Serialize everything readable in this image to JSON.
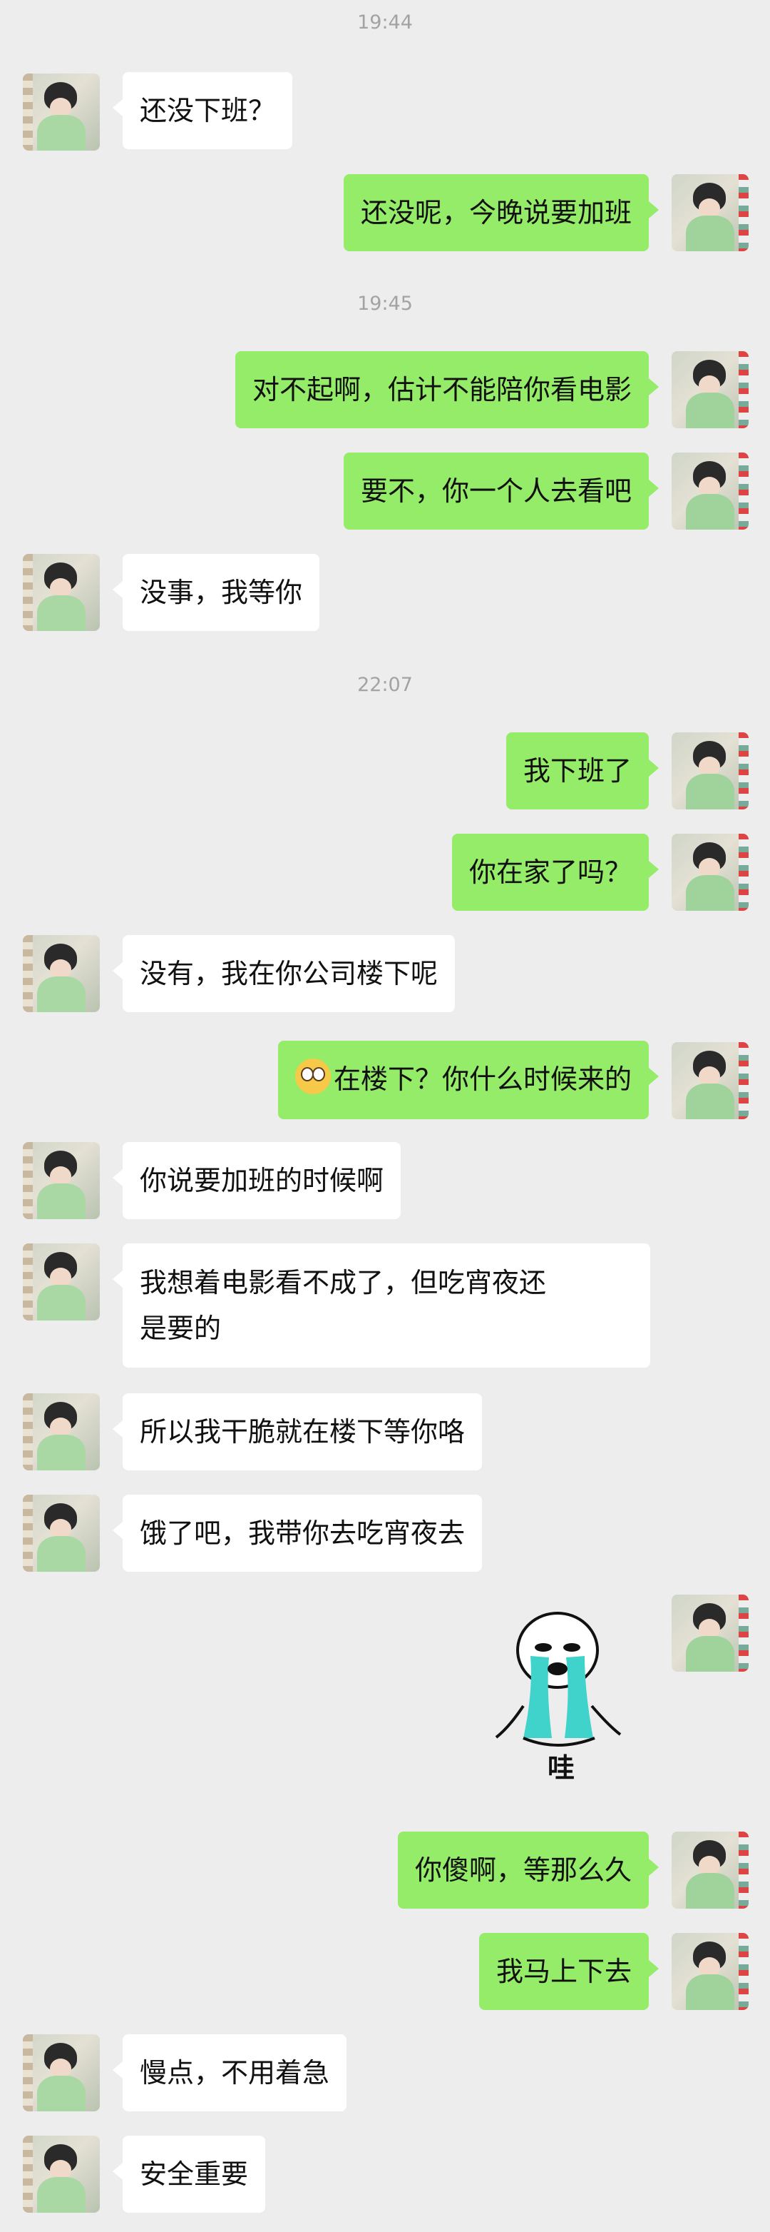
{
  "times": [
    "19:44",
    "19:45",
    "22:07"
  ],
  "messages": [
    {
      "side": "in",
      "text": "还没下班？"
    },
    {
      "side": "out",
      "text": "还没呢，今晚说要加班"
    },
    {
      "side": "out",
      "text": "对不起啊，估计不能陪你看电影"
    },
    {
      "side": "out",
      "text": "要不，你一个人去看吧"
    },
    {
      "side": "in",
      "text": "没事，我等你"
    },
    {
      "side": "out",
      "text": "我下班了"
    },
    {
      "side": "out",
      "text": "你在家了吗？"
    },
    {
      "side": "in",
      "text": "没有，我在你公司楼下呢"
    },
    {
      "side": "out",
      "text": "在楼下？你什么时候来的",
      "emoji": "flushed-face-icon"
    },
    {
      "side": "in",
      "text": "你说要加班的时候啊"
    },
    {
      "side": "in",
      "line1": "我想着电影看不成了，但吃宵夜还",
      "line2": "是要的"
    },
    {
      "side": "in",
      "text": "所以我干脆就在楼下等你咯"
    },
    {
      "side": "in",
      "text": "饿了吧，我带你去吃宵夜去"
    },
    {
      "side": "out",
      "sticker": "crying-meme-sticker",
      "caption": "哇"
    },
    {
      "side": "out",
      "text": "你傻啊，等那么久"
    },
    {
      "side": "out",
      "text": "我马上下去"
    },
    {
      "side": "in",
      "text": "慢点，不用着急"
    },
    {
      "side": "in",
      "text": "安全重要"
    }
  ],
  "colors": {
    "background": "#ededed",
    "incoming_bubble": "#ffffff",
    "outgoing_bubble": "#95ec69",
    "timestamp": "#a3a3a3"
  }
}
